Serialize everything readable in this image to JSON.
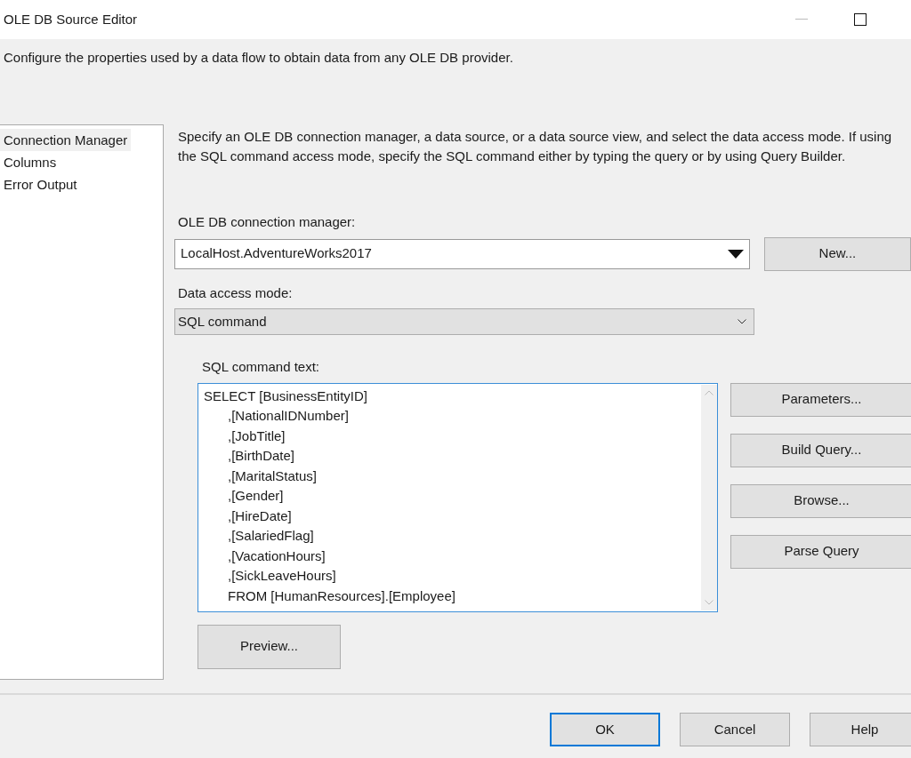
{
  "window": {
    "title": "OLE DB Source Editor"
  },
  "description": "Configure the properties used by a data flow to obtain data from any OLE DB provider.",
  "sidebar": {
    "items": [
      {
        "label": "Connection Manager",
        "selected": true
      },
      {
        "label": "Columns",
        "selected": false
      },
      {
        "label": "Error Output",
        "selected": false
      }
    ]
  },
  "instructions": "Specify an OLE DB connection manager, a data source, or a data source view, and select the data access mode. If using the SQL command access mode, specify the SQL command either by typing the query or by using Query Builder.",
  "connection_manager": {
    "label": "OLE DB connection manager:",
    "value": "LocalHost.AdventureWorks2017",
    "button": "New..."
  },
  "data_access_mode": {
    "label": "Data access mode:",
    "value": "SQL command"
  },
  "sql_command": {
    "label": "SQL command text:",
    "lines": [
      "SELECT [BusinessEntityID]",
      "\t,[NationalIDNumber]",
      "\t,[JobTitle]",
      "\t,[BirthDate]",
      "\t,[MaritalStatus]",
      "\t,[Gender]",
      "\t,[HireDate]",
      "\t,[SalariedFlag]",
      "\t,[VacationHours]",
      "\t,[SickLeaveHours]",
      "\tFROM [HumanResources].[Employee]"
    ],
    "buttons": [
      "Parameters...",
      "Build Query...",
      "Browse...",
      "Parse Query"
    ]
  },
  "preview_button": "Preview...",
  "footer_buttons": [
    {
      "label": "OK",
      "default": true
    },
    {
      "label": "Cancel",
      "default": false
    },
    {
      "label": "Help",
      "default": false
    }
  ]
}
